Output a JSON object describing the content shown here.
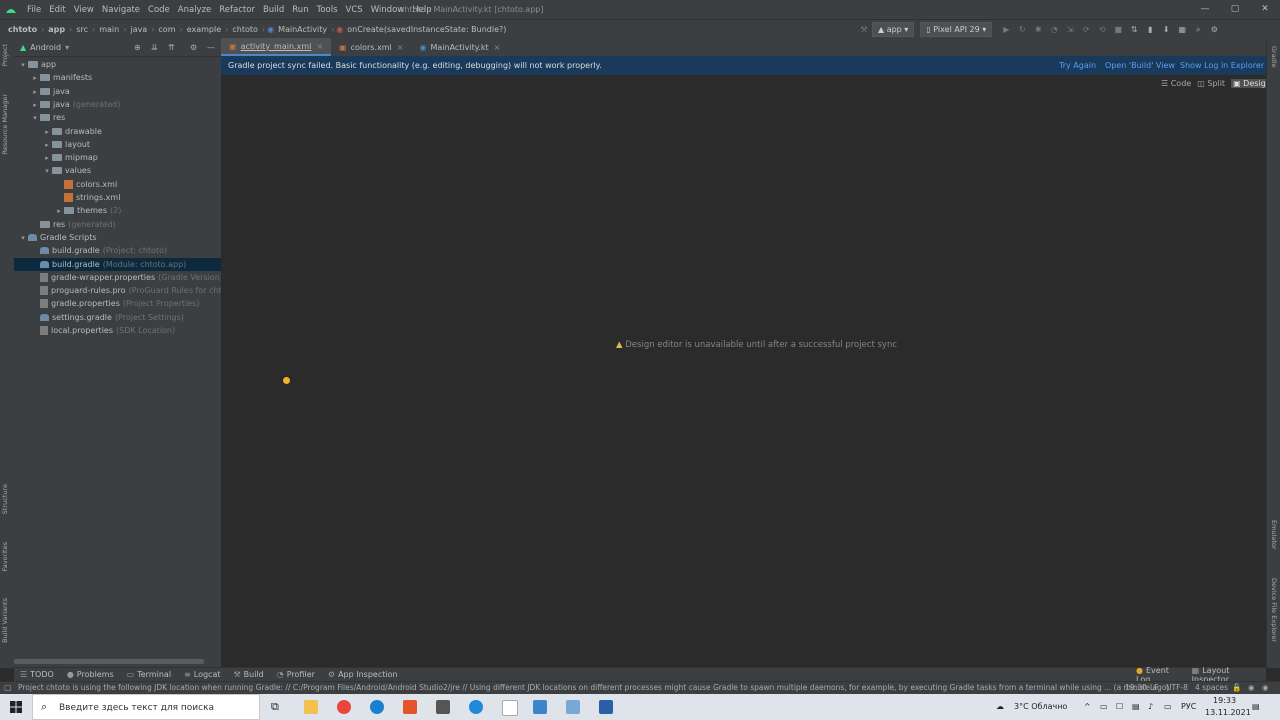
{
  "menubar": {
    "items": [
      "File",
      "Edit",
      "View",
      "Navigate",
      "Code",
      "Analyze",
      "Refactor",
      "Build",
      "Run",
      "Tools",
      "VCS",
      "Window",
      "Help"
    ],
    "title": "chtoto - MainActivity.kt [chtoto.app]"
  },
  "navbar": {
    "crumbs": [
      "chtoto",
      "app",
      "src",
      "main",
      "java",
      "com",
      "example",
      "chtoto",
      "MainActivity",
      "onCreate(savedInstanceState: Bundle?)"
    ],
    "run_config": "app",
    "device": "Pixel API 29"
  },
  "project_panel": {
    "view_selector": "Android",
    "tree": [
      {
        "label": "app",
        "sub": "",
        "indent": 0,
        "icon": "folder",
        "arrow": "▾"
      },
      {
        "label": "manifests",
        "sub": "",
        "indent": 1,
        "icon": "folder",
        "arrow": "▸"
      },
      {
        "label": "java",
        "sub": "",
        "indent": 1,
        "icon": "folder",
        "arrow": "▸"
      },
      {
        "label": "java",
        "sub": "(generated)",
        "indent": 1,
        "icon": "folder",
        "arrow": "▸"
      },
      {
        "label": "res",
        "sub": "",
        "indent": 1,
        "icon": "folder",
        "arrow": "▾"
      },
      {
        "label": "drawable",
        "sub": "",
        "indent": 2,
        "icon": "folder",
        "arrow": "▸"
      },
      {
        "label": "layout",
        "sub": "",
        "indent": 2,
        "icon": "folder",
        "arrow": "▸"
      },
      {
        "label": "mipmap",
        "sub": "",
        "indent": 2,
        "icon": "folder",
        "arrow": "▸"
      },
      {
        "label": "values",
        "sub": "",
        "indent": 2,
        "icon": "folder",
        "arrow": "▾"
      },
      {
        "label": "colors.xml",
        "sub": "",
        "indent": 3,
        "icon": "xml",
        "arrow": ""
      },
      {
        "label": "strings.xml",
        "sub": "",
        "indent": 3,
        "icon": "xml",
        "arrow": ""
      },
      {
        "label": "themes",
        "sub": "(2)",
        "indent": 3,
        "icon": "folder",
        "arrow": "▸"
      },
      {
        "label": "res",
        "sub": "(generated)",
        "indent": 1,
        "icon": "folder",
        "arrow": ""
      },
      {
        "label": "Gradle Scripts",
        "sub": "",
        "indent": 0,
        "icon": "gradle",
        "arrow": "▾"
      },
      {
        "label": "build.gradle",
        "sub": "(Project: chtoto)",
        "indent": 1,
        "icon": "gradle",
        "arrow": ""
      },
      {
        "label": "build.gradle",
        "sub": "(Module: chtoto.app)",
        "indent": 1,
        "icon": "gradle",
        "arrow": "",
        "selected": true
      },
      {
        "label": "gradle-wrapper.properties",
        "sub": "(Gradle Version)",
        "indent": 1,
        "icon": "prop",
        "arrow": ""
      },
      {
        "label": "proguard-rules.pro",
        "sub": "(ProGuard Rules for chtoto.",
        "indent": 1,
        "icon": "prop",
        "arrow": ""
      },
      {
        "label": "gradle.properties",
        "sub": "(Project Properties)",
        "indent": 1,
        "icon": "prop",
        "arrow": ""
      },
      {
        "label": "settings.gradle",
        "sub": "(Project Settings)",
        "indent": 1,
        "icon": "gradle",
        "arrow": ""
      },
      {
        "label": "local.properties",
        "sub": "(SDK Location)",
        "indent": 1,
        "icon": "prop",
        "arrow": ""
      }
    ]
  },
  "tabs": [
    {
      "label": "activity_main.xml",
      "active": true
    },
    {
      "label": "colors.xml",
      "active": false
    },
    {
      "label": "MainActivity.kt",
      "active": false
    }
  ],
  "banner": {
    "message": "Gradle project sync failed. Basic functionality (e.g. editing, debugging) will not work properly.",
    "try_again": "Try Again",
    "open_build": "Open 'Build' View",
    "show_log": "Show Log in Explorer"
  },
  "view_mode": {
    "code": "Code",
    "split": "Split",
    "design": "Design"
  },
  "editor": {
    "design_message": "Design editor is unavailable until after a successful project sync"
  },
  "left_strip": {
    "project": "Project",
    "resource_manager": "Resource Manager",
    "structure": "Structure",
    "favorites": "Favorites",
    "build_variants": "Build Variants"
  },
  "right_strip": {
    "gradle": "Gradle",
    "emulator": "Emulator",
    "device_explorer": "Device File Explorer"
  },
  "bottom_tools": [
    "TODO",
    "Problems",
    "Terminal",
    "Logcat",
    "Build",
    "Profiler",
    "App Inspection"
  ],
  "bottom_right_tools": [
    "Event Log",
    "Layout Inspector"
  ],
  "status": {
    "message": "Project chtoto is using the following JDK location when running Gradle: // C:/Program Files/Android/Android Studio2/jre // Using different JDK locations on different processes might cause Gradle to spawn multiple daemons, for example, by executing Gradle tasks from a terminal while using ... (a minute ago)",
    "position": "19:30",
    "line_sep": "LF",
    "encoding": "UTF-8",
    "indent": "4 spaces"
  },
  "taskbar": {
    "search_placeholder": "Введите здесь текст для поиска",
    "weather": "3°C  Облачно",
    "lang": "РУС",
    "time": "19:33",
    "date": "13.11.2021"
  }
}
